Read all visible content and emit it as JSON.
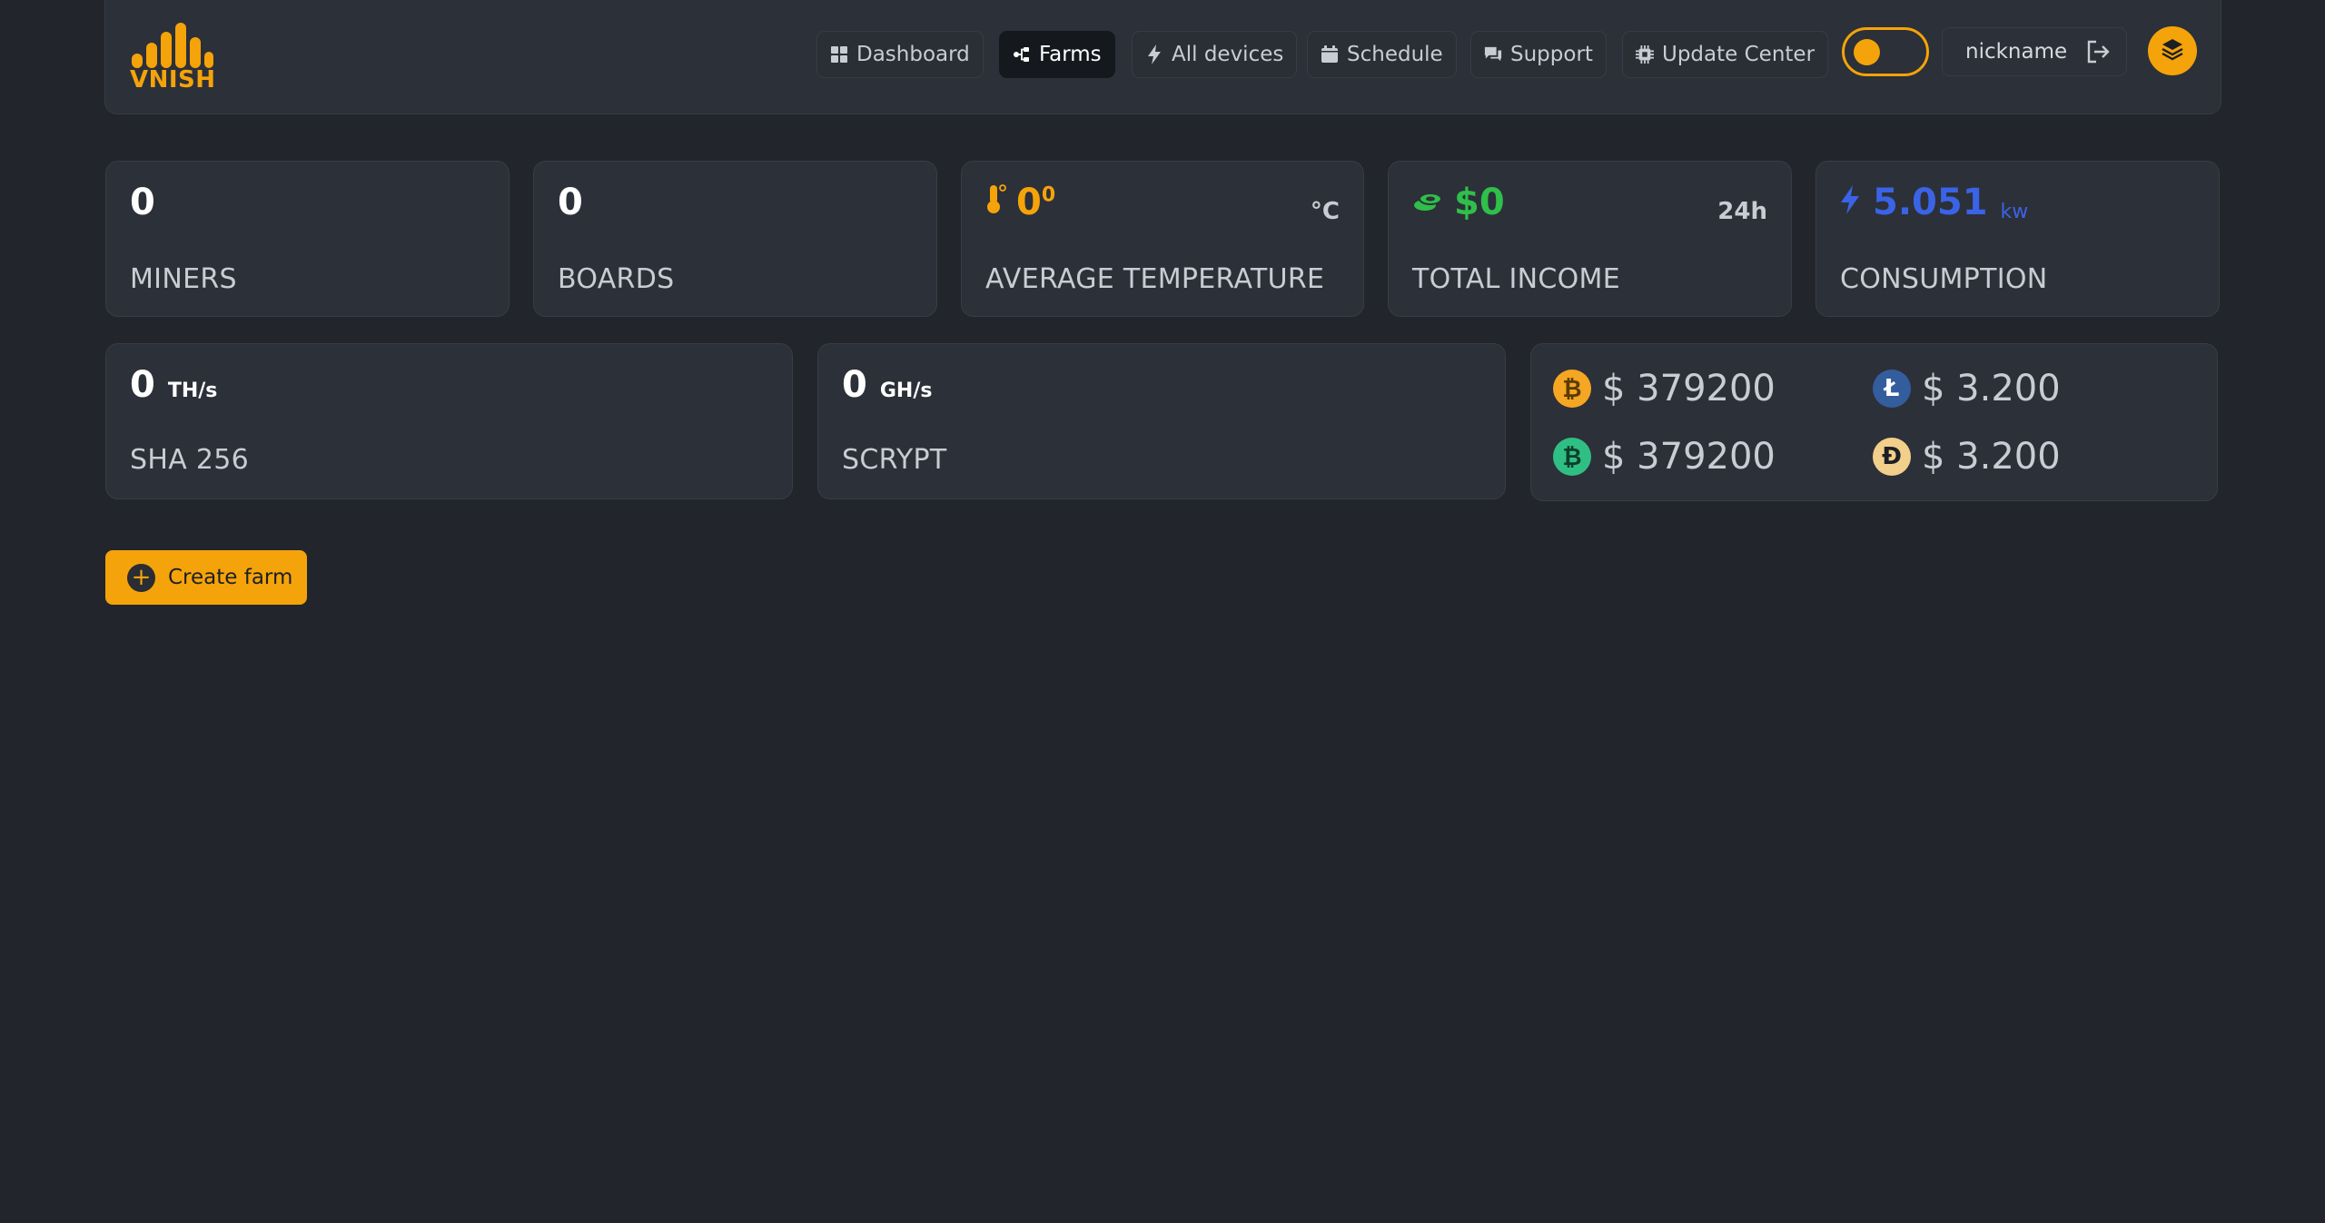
{
  "brand": {
    "name": "VNISH",
    "color": "#f5a30a"
  },
  "nav": [
    {
      "label": "Dashboard",
      "icon": "grid-icon",
      "active": false
    },
    {
      "label": "Farms",
      "icon": "network-icon",
      "active": true
    },
    {
      "label": "All devices",
      "icon": "bolt-icon",
      "active": false
    },
    {
      "label": "Schedule",
      "icon": "calendar-icon",
      "active": false
    },
    {
      "label": "Support",
      "icon": "chat-icon",
      "active": false
    },
    {
      "label": "Update Center",
      "icon": "chip-icon",
      "active": false
    }
  ],
  "user": {
    "nickname": "nickname"
  },
  "stats": {
    "miners": {
      "value": "0",
      "label": "MINERS"
    },
    "boards": {
      "value": "0",
      "label": "BOARDS"
    },
    "temperature": {
      "value": "0",
      "sup": "0",
      "unit": "°C",
      "label": "AVERAGE TEMPERATURE"
    },
    "income": {
      "value": "$0",
      "period": "24h",
      "label": "TOTAL INCOME"
    },
    "consumption": {
      "value": "5.051",
      "unit": "kw",
      "label": "CONSUMPTION"
    }
  },
  "hashrate": {
    "sha": {
      "value": "0",
      "unit": "TH/s",
      "label": "SHA 256"
    },
    "scrypt": {
      "value": "0",
      "unit": "GH/s",
      "label": "SCRYPT"
    }
  },
  "prices": [
    {
      "coin": "bitcoin-icon",
      "symbol": "₿",
      "value": "$ 379200",
      "color": "#f5a623"
    },
    {
      "coin": "litecoin-icon",
      "symbol": "Ł",
      "value": "$ 3.200",
      "color": "#345d9d"
    },
    {
      "coin": "bitcoin-cash-icon",
      "symbol": "₿",
      "value": "$ 379200",
      "color": "#2fbf85"
    },
    {
      "coin": "dogecoin-icon",
      "symbol": "Ð",
      "value": "$ 3.200",
      "color": "#f2cf8a"
    }
  ],
  "actions": {
    "create_farm": "Create farm"
  },
  "colors": {
    "income": "#2fbf4a",
    "consumption": "#3b63e6",
    "accent": "#f5a30a"
  }
}
